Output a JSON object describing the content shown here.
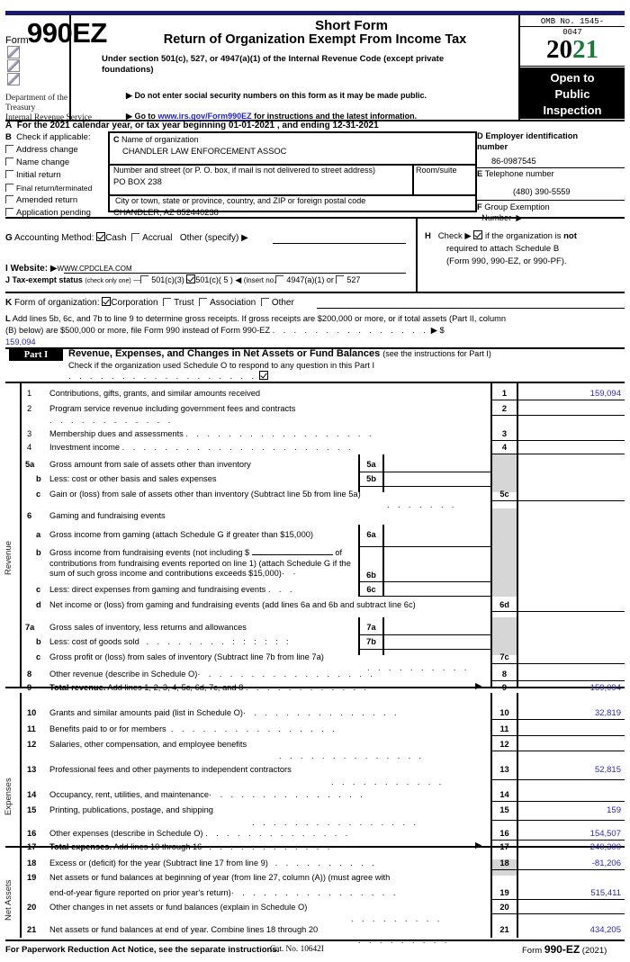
{
  "header": {
    "form_word": "Form",
    "form_number": "990EZ",
    "dept_lines": [
      "Department of the",
      "Treasury",
      "Internal Revenue Service"
    ],
    "short_form": "Short Form",
    "title": "Return of Organization Exempt From Income Tax",
    "under_section": "Under section 501(c), 527, or 4947(a)(1) of the Internal Revenue Code (except private foundations)",
    "do_not_enter": "Do not enter social security numbers on this form as it may be made public.",
    "goto_prefix": "Go to ",
    "goto_link": "www.irs.gov/Form990EZ",
    "goto_suffix": " for instructions and the latest information.",
    "omb_line1": "OMB No. 1545-",
    "omb_line2": "0047",
    "year_black": "20",
    "year_green": "21",
    "open_tag": "Open to Public Inspection",
    "open_tag_l1": "Open to",
    "open_tag_l2": "Public",
    "open_tag_l3": "Inspection",
    "accent_green": "#1f7a3d",
    "accent_navy": "#1b1b6e",
    "value_blue": "#2a2ab0"
  },
  "line_a": {
    "letter": "A",
    "text_before": "For the 2021 calendar year, or tax year beginning",
    "begin_date": "01-01-2021",
    "text_mid": ", and ending",
    "end_date": "12-31-2021"
  },
  "box_b": {
    "letter": "B",
    "title": "Check if applicable:",
    "items": [
      {
        "label": "Address change",
        "checked": false
      },
      {
        "label": "Name change",
        "checked": false
      },
      {
        "label": "Initial return",
        "checked": false
      },
      {
        "label": "Final return/terminated",
        "checked": false
      },
      {
        "label": "Amended return",
        "checked": false
      },
      {
        "label": "Application pending",
        "checked": false
      }
    ]
  },
  "box_c": {
    "letter": "C",
    "name_label": "Name of organization",
    "org_name": "CHANDLER LAW ENFORCEMENT ASSOC",
    "street_label": "Number and street (or P. O. box, if mail is not delivered to street address)",
    "room_label": "Room/suite",
    "street": "PO BOX 238",
    "city_label": "City or town, state or province, country, and ZIP or foreign postal code",
    "city": "CHANDLER, AZ   852440238"
  },
  "box_d": {
    "letter": "D",
    "label_l1": "Employer identification",
    "label_l2": "number",
    "ein": "86-0987545"
  },
  "box_e": {
    "letter": "E",
    "label": "Telephone number",
    "phone": "(480) 390-5559"
  },
  "box_f": {
    "letter": "F",
    "label_l1": "Group Exemption",
    "label_l2": "Number",
    "value": ""
  },
  "line_g": {
    "letter": "G",
    "label": "Accounting Method:",
    "cash": "Cash",
    "cash_checked": true,
    "accrual": "Accrual",
    "accrual_checked": false,
    "other": "Other (specify)",
    "other_value": ""
  },
  "box_h": {
    "letter": "H",
    "check_word": "Check",
    "checked": true,
    "text_l1_a": "if the organization is ",
    "text_l1_b": "not",
    "text_l2": "required to attach Schedule B",
    "text_l3": "(Form 990, 990-EZ, or 990-PF)."
  },
  "line_i": {
    "letter": "I",
    "label": "Website:",
    "value": "WWW.CPDCLEA.COM"
  },
  "line_j": {
    "letter": "J",
    "label": "Tax-exempt status",
    "sub": "(check only one)",
    "opt1": "501(c)(3)",
    "opt1_checked": false,
    "opt2": "501(c)(  5  )",
    "opt2_checked": true,
    "insert": "(insert no.",
    "opt3": "4947(a)(1) or",
    "opt3_checked": false,
    "opt4": "527",
    "opt4_checked": false
  },
  "line_k": {
    "letter": "K",
    "label": "Form of organization:",
    "options": [
      {
        "label": "Corporation",
        "checked": true
      },
      {
        "label": "Trust",
        "checked": false
      },
      {
        "label": "Association",
        "checked": false
      },
      {
        "label": "Other",
        "checked": false
      }
    ],
    "other_value": ""
  },
  "line_l": {
    "letter": "L",
    "text_l1": "Add lines 5b, 6c, and 7b to line 9 to determine gross receipts. If gross receipts are $200,000 or more, or if total assets (Part II, column",
    "text_l2": "(B) below) are $500,000 or more, file Form 990 instead of Form 990-EZ",
    "dollar": "$",
    "value": "159,094"
  },
  "part1": {
    "tag": "Part I",
    "title": "Revenue, Expenses, and Changes in Net Assets or Fund Balances",
    "title_note": "(see the instructions for Part I)",
    "schedule_o": "Check if the organization used Schedule O to respond to any question in this Part I",
    "schedule_o_checked": true
  },
  "side_labels": {
    "revenue": "Revenue",
    "expenses": "Expenses",
    "net_assets": "Net Assets"
  },
  "rows": [
    {
      "no": "1",
      "text": "Contributions, gifts, grants, and similar amounts received",
      "box": "1",
      "value": "159,094"
    },
    {
      "no": "2",
      "text": "Program service revenue including government fees and contracts",
      "box": "2",
      "value": ""
    },
    {
      "no": "3",
      "text": "Membership dues and assessments",
      "box": "3",
      "value": ""
    },
    {
      "no": "4",
      "text": "Investment income",
      "box": "4",
      "value": ""
    },
    {
      "no": "5a",
      "text": "Gross amount from sale of assets other than inventory",
      "box": "5a",
      "value": "",
      "sub": true
    },
    {
      "no": "b",
      "text": "Less: cost or other basis and sales expenses",
      "box": "5b",
      "value": "",
      "sub": true
    },
    {
      "no": "c",
      "text": "Gain or (loss) from sale of assets other than inventory (Subtract line 5b from line 5a)",
      "box": "5c",
      "value": ""
    },
    {
      "no": "6",
      "text": "Gaming and fundraising events",
      "box": "",
      "value": ""
    },
    {
      "no": "a",
      "text": "Gross income from gaming (attach Schedule G if greater than $15,000)",
      "box": "6a",
      "value": "",
      "sub": true
    },
    {
      "no": "b",
      "text": "Gross income from fundraising events (not including $ ______________ of contributions from fundraising events reported on line 1) (attach Schedule G if the sum of such gross income and contributions exceeds $15,000)",
      "box": "6b",
      "value": "",
      "sub": true
    },
    {
      "no": "c",
      "text": "Less: direct expenses from gaming and fundraising events",
      "box": "6c",
      "value": "",
      "sub": true
    },
    {
      "no": "d",
      "text": "Net income or (loss) from gaming and fundraising events (add lines 6a and 6b and subtract line 6c)",
      "box": "6d",
      "value": ""
    },
    {
      "no": "7a",
      "text": "Gross sales of inventory, less returns and allowances",
      "box": "7a",
      "value": "",
      "sub": true
    },
    {
      "no": "b",
      "text": "Less: cost of goods sold",
      "box": "7b",
      "value": "",
      "sub": true
    },
    {
      "no": "c",
      "text": "Gross profit or (loss) from sales of inventory (Subtract line 7b from line 7a)",
      "box": "7c",
      "value": ""
    },
    {
      "no": "8",
      "text": "Other revenue (describe in Schedule O)",
      "box": "8",
      "value": ""
    },
    {
      "no": "9",
      "text": "Total revenue. Add lines 1, 2, 3, 4, 5c, 6d, 7c, and 8",
      "box": "9",
      "value": "159,094",
      "bold_lead": "Total revenue."
    },
    {
      "no": "10",
      "text": "Grants and similar amounts paid (list in Schedule O)",
      "box": "10",
      "value": "32,819"
    },
    {
      "no": "11",
      "text": "Benefits paid to or for members",
      "box": "11",
      "value": ""
    },
    {
      "no": "12",
      "text": "Salaries, other compensation, and employee benefits",
      "box": "12",
      "value": ""
    },
    {
      "no": "13",
      "text": "Professional fees and other payments to independent contractors",
      "box": "13",
      "value": "52,815"
    },
    {
      "no": "14",
      "text": "Occupancy, rent, utilities, and maintenance",
      "box": "14",
      "value": ""
    },
    {
      "no": "15",
      "text": "Printing, publications, postage, and shipping",
      "box": "15",
      "value": "159"
    },
    {
      "no": "16",
      "text": "Other expenses (describe in Schedule O)",
      "box": "16",
      "value": "154,507"
    },
    {
      "no": "17",
      "text": "Total expenses. Add lines 10 through 16",
      "box": "17",
      "value": "240,300",
      "bold_lead": "Total expenses."
    },
    {
      "no": "18",
      "text": "Excess or (deficit) for the year (Subtract line 17 from line 9)",
      "box": "18",
      "value": "-81,206"
    },
    {
      "no": "19",
      "text": "Net assets or fund balances at beginning of year (from line 27, column (A)) (must agree with end-of-year figure reported on prior year's return)",
      "box": "19",
      "value": "515,411"
    },
    {
      "no": "20",
      "text": "Other changes in net assets or fund balances (explain in Schedule O)",
      "box": "20",
      "value": ""
    },
    {
      "no": "21",
      "text": "Net assets or fund balances at end of year. Combine lines 18 through 20",
      "box": "21",
      "value": "434,205"
    }
  ],
  "footer": {
    "left": "For Paperwork Reduction Act Notice, see the separate instructions.",
    "center": "Cat. No. 10642I",
    "right_pre": "Form ",
    "right_bold": "990-EZ",
    "right_post": " (2021)"
  }
}
